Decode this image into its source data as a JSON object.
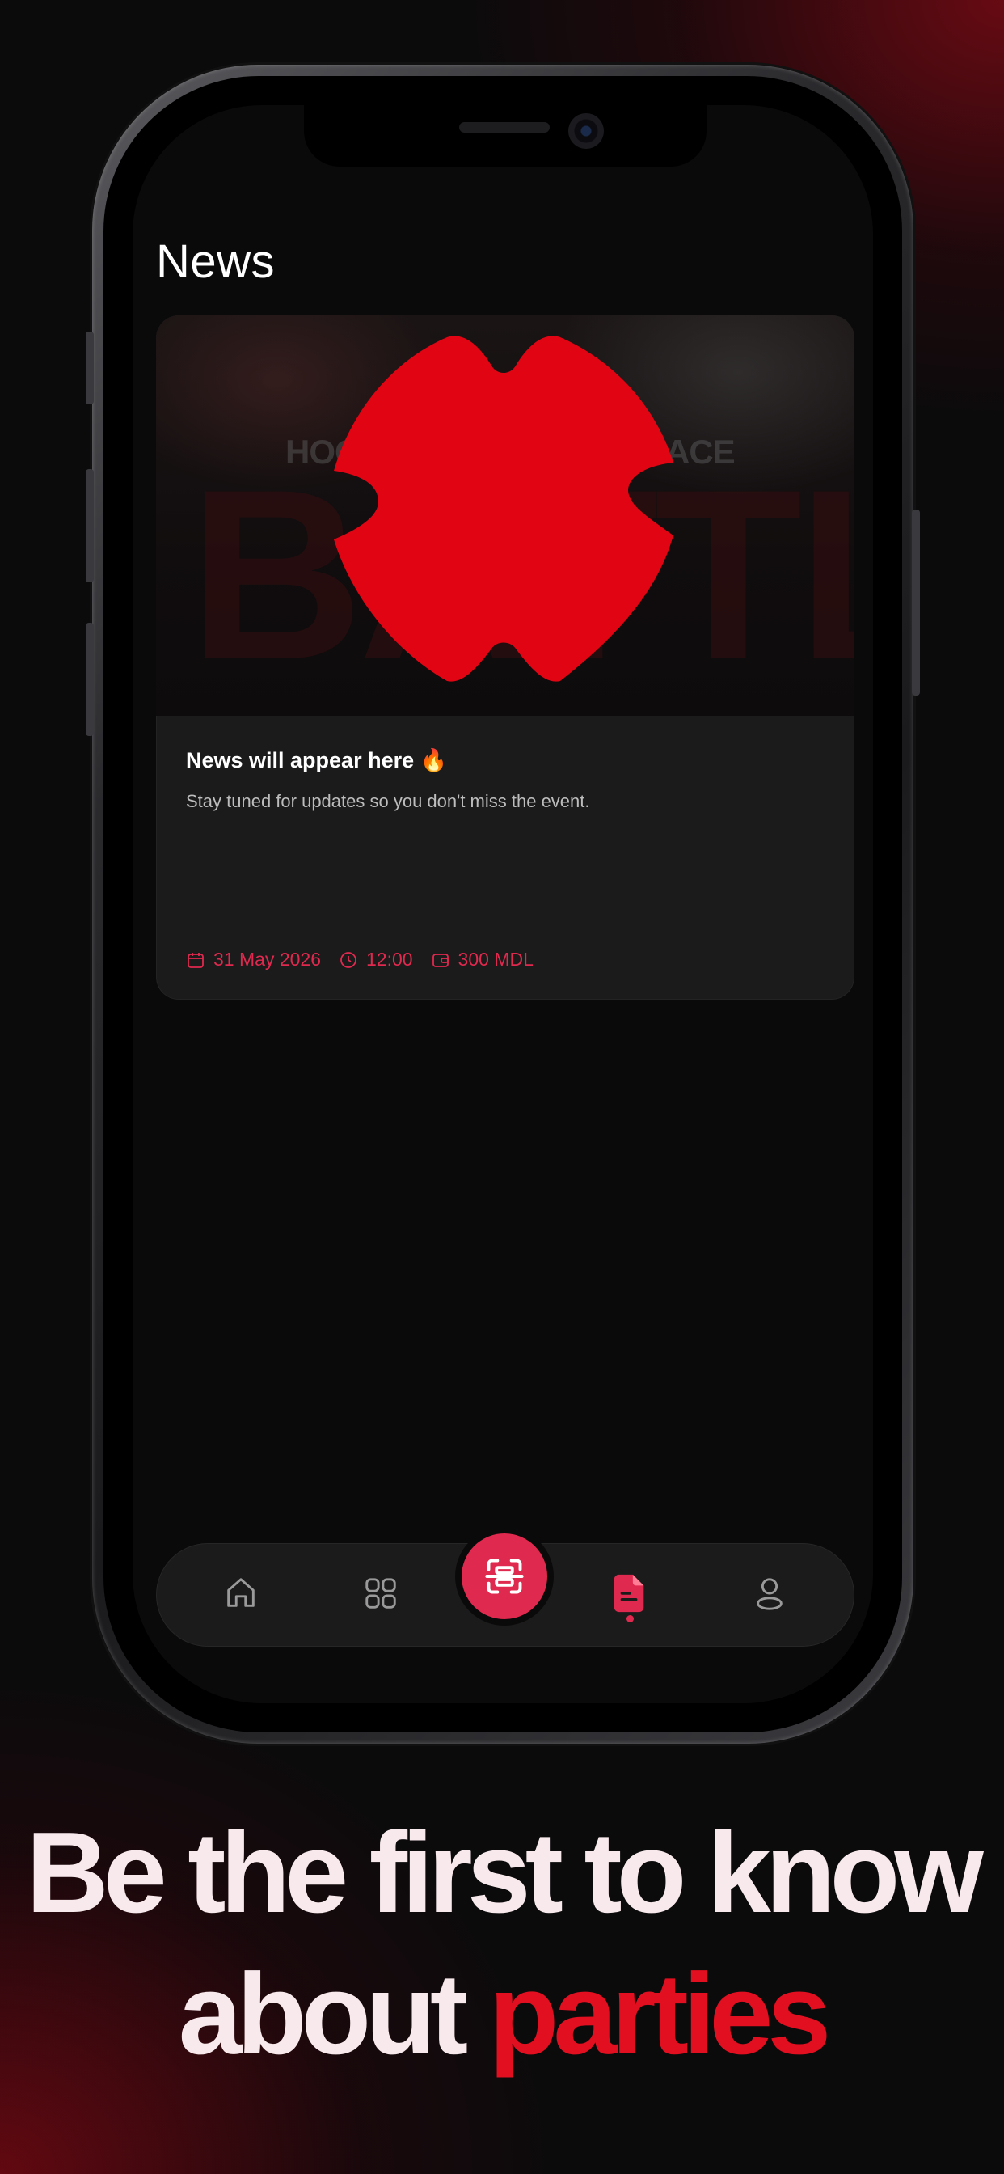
{
  "screen": {
    "title": "News"
  },
  "news_card": {
    "image_words": {
      "big": "BATTLE",
      "small_left": "HOO",
      "small_right": "ACE"
    },
    "heading": "News will appear here 🔥",
    "description": "Stay tuned for updates so you don't miss the event.",
    "date": "31 May 2026",
    "time": "12:00",
    "price": "300 MDL",
    "icons": [
      "calendar-icon",
      "clock-icon",
      "wallet-icon"
    ]
  },
  "bottom_nav": {
    "items": [
      {
        "name": "home-icon",
        "active": false
      },
      {
        "name": "grid-icon",
        "active": false
      },
      {
        "name": "scan-icon",
        "active": false
      },
      {
        "name": "news-icon",
        "active": true
      },
      {
        "name": "profile-icon",
        "active": false
      }
    ]
  },
  "promo": {
    "line1": "Be the first to know",
    "line2_plain": "about",
    "line2_accent": "parties"
  },
  "colors": {
    "accent": "#e0294e",
    "headline_accent": "#e10f1f",
    "background": "#0b0b0c",
    "card": "#1b1b1c"
  }
}
